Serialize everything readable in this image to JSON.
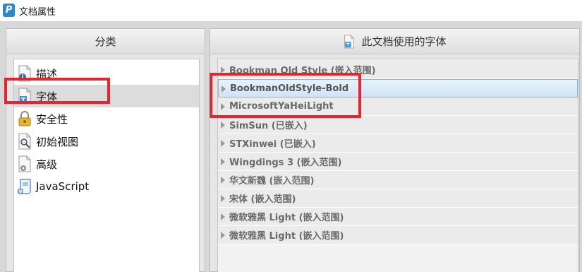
{
  "window": {
    "title": "文档属性",
    "logo_letter": "P"
  },
  "left": {
    "header": "分类",
    "items": [
      {
        "label": "描述",
        "icon": "document-info-icon"
      },
      {
        "label": "字体",
        "icon": "font-document-icon",
        "selected": true
      },
      {
        "label": "安全性",
        "icon": "lock-icon"
      },
      {
        "label": "初始视图",
        "icon": "magnifier-document-icon"
      },
      {
        "label": "高级",
        "icon": "gear-document-icon"
      },
      {
        "label": "JavaScript",
        "icon": "script-scroll-icon"
      }
    ]
  },
  "right": {
    "header": "此文档使用的字体",
    "header_icon": "font-document-icon",
    "fonts": [
      {
        "name": "Bookman Old Style (嵌入范围)"
      },
      {
        "name": "BookmanOldStyle-Bold",
        "selected": true
      },
      {
        "name": "MicrosoftYaHeiLight"
      },
      {
        "name": "SimSun (已嵌入)"
      },
      {
        "name": "STXinwei (已嵌入)"
      },
      {
        "name": "Wingdings 3 (嵌入范围)"
      },
      {
        "name": "华文新魏 (嵌入范围)"
      },
      {
        "name": "宋体 (嵌入范围)"
      },
      {
        "name": "微软雅黑 Light (嵌入范围)"
      },
      {
        "name": "微软雅黑 Light (嵌入范围)"
      }
    ]
  },
  "colors": {
    "highlight_red": "#e3262f",
    "selection_blue": "#cfe3f7",
    "logo_blue": "#2f86c8"
  }
}
